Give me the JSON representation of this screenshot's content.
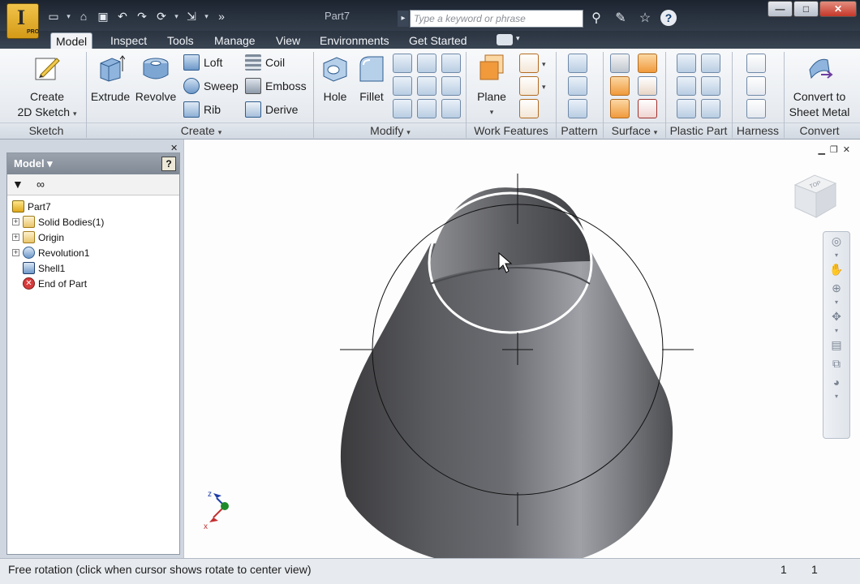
{
  "app": {
    "pro_badge": "PRO",
    "doc_title": "Part7"
  },
  "search": {
    "placeholder": "Type a keyword or phrase"
  },
  "tabs": [
    "Model",
    "Inspect",
    "Tools",
    "Manage",
    "View",
    "Environments",
    "Get Started"
  ],
  "ribbon": {
    "sketch": {
      "create_line1": "Create",
      "create_line2": "2D Sketch",
      "panel": "Sketch"
    },
    "create": {
      "extrude": "Extrude",
      "revolve": "Revolve",
      "loft": "Loft",
      "sweep": "Sweep",
      "rib": "Rib",
      "coil": "Coil",
      "emboss": "Emboss",
      "derive": "Derive",
      "panel": "Create"
    },
    "modify": {
      "hole": "Hole",
      "fillet": "Fillet",
      "panel": "Modify"
    },
    "work": {
      "plane": "Plane",
      "panel": "Work Features"
    },
    "pattern": {
      "panel": "Pattern"
    },
    "surface": {
      "panel": "Surface"
    },
    "plastic": {
      "panel": "Plastic Part"
    },
    "harness": {
      "panel": "Harness"
    },
    "convert": {
      "line1": "Convert to",
      "line2": "Sheet Metal",
      "panel": "Convert"
    }
  },
  "browser": {
    "title": "Model",
    "help": "?",
    "items": [
      {
        "label": "Part7",
        "expandable": false,
        "level": 0
      },
      {
        "label": "Solid Bodies(1)",
        "expandable": true,
        "level": 1
      },
      {
        "label": "Origin",
        "expandable": true,
        "level": 1
      },
      {
        "label": "Revolution1",
        "expandable": true,
        "level": 1
      },
      {
        "label": "Shell1",
        "expandable": false,
        "level": 1
      },
      {
        "label": "End of Part",
        "expandable": false,
        "level": 1
      }
    ]
  },
  "viewcube": {
    "face": "TOP"
  },
  "triad": {
    "z": "z",
    "x": "x"
  },
  "status": {
    "message": "Free rotation (click when cursor shows rotate to center view)",
    "n1": "1",
    "n2": "1"
  }
}
